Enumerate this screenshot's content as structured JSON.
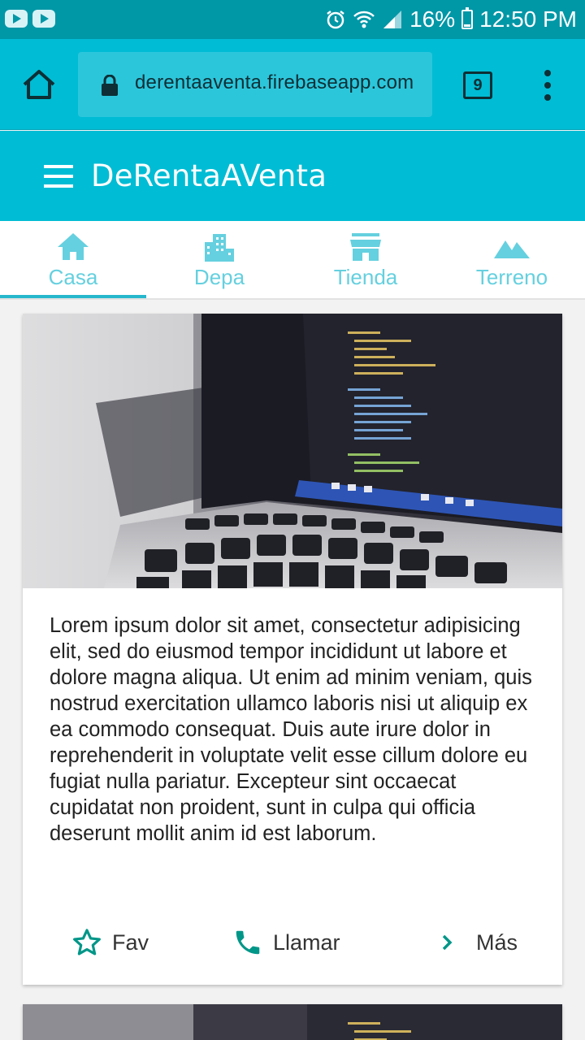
{
  "status_bar": {
    "battery": "16%",
    "time": "12:50 PM"
  },
  "browser": {
    "url": "derentaaventa.firebaseapp.com",
    "tab_count": "9"
  },
  "app": {
    "title": "DeRentaAVenta"
  },
  "tabs": [
    {
      "label": "Casa",
      "icon": "home-icon",
      "selected": true
    },
    {
      "label": "Depa",
      "icon": "city-icon",
      "selected": false
    },
    {
      "label": "Tienda",
      "icon": "store-icon",
      "selected": false
    },
    {
      "label": "Terreno",
      "icon": "terrain-icon",
      "selected": false
    }
  ],
  "card": {
    "image": "laptop-code-photo",
    "text": "Lorem ipsum dolor sit amet, consectetur adipisicing elit, sed do eiusmod tempor incididunt ut labore et dolore magna aliqua. Ut enim ad minim veniam, quis nostrud exercitation ullamco laboris nisi ut aliquip ex ea commodo consequat. Duis aute irure dolor in reprehenderit in voluptate velit esse cillum dolore eu fugiat nulla pariatur. Excepteur sint occaecat cupidatat non proident, sunt in culpa qui officia deserunt mollit anim id est laborum.",
    "actions": {
      "fav": "Fav",
      "call": "Llamar",
      "more": "Más"
    }
  },
  "colors": {
    "status_bar": "#0097a7",
    "primary": "#00bcd4",
    "tab_text": "#65d0df",
    "action_icon": "#009688"
  }
}
